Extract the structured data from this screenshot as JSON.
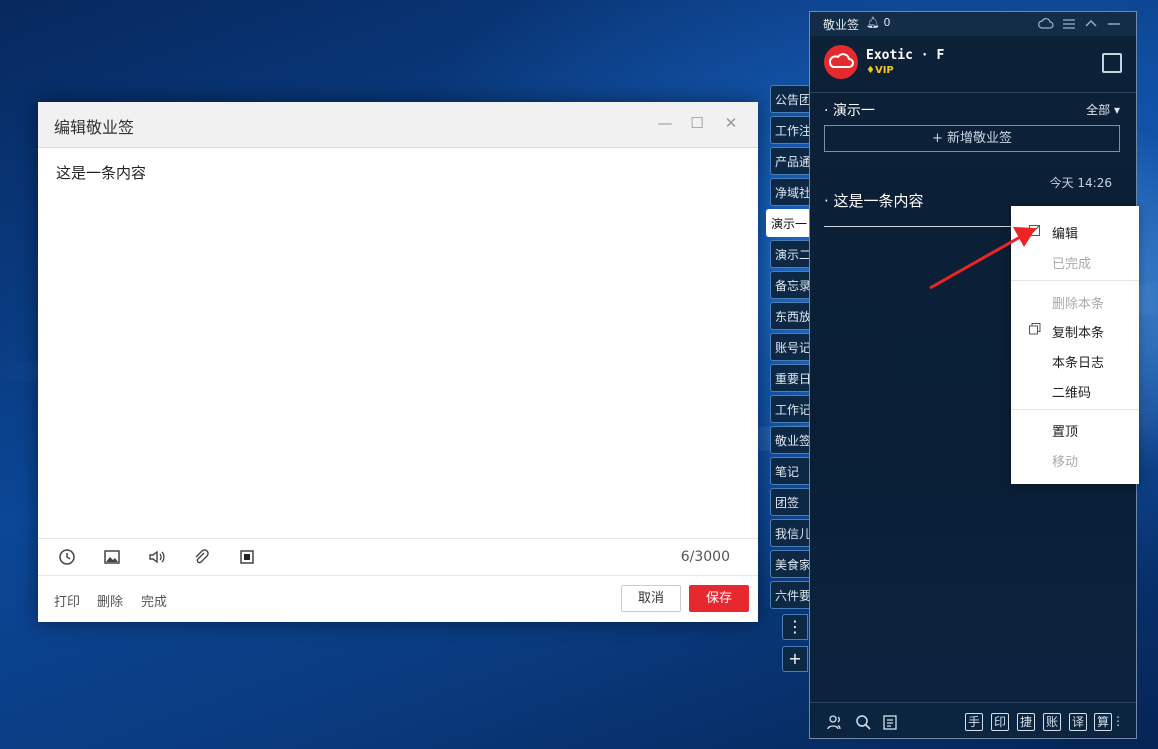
{
  "editor": {
    "title": "编辑敬业签",
    "content": "这是一条内容",
    "char_count": "6/3000",
    "footer_links": [
      "打印",
      "删除",
      "完成"
    ],
    "cancel_label": "取消",
    "save_label": "保存",
    "tool_icons": [
      "clock-icon",
      "image-icon",
      "speaker-icon",
      "attachment-icon",
      "stop-icon"
    ]
  },
  "tabs": [
    "公告团",
    "工作注",
    "产品通",
    "净域社",
    "演示一",
    "演示二",
    "备忘录",
    "东西放",
    "账号记",
    "重要日",
    "工作记",
    "敬业签",
    "笔记",
    "团签",
    "我信儿",
    "美食家",
    "六件要"
  ],
  "active_tab": "演示一",
  "tab_more": "⋮",
  "tab_add": "+",
  "panel": {
    "app_name": "敬业签",
    "notification_count": "0",
    "user_name": "Exotic · F",
    "vip_label": "VIP",
    "group_name": "演示一",
    "filter_label": "全部",
    "add_note_label": "+ 新增敬业签",
    "note_time": "今天 14:26",
    "note_text": "这是一条内容",
    "bottom_right_icons": [
      "手",
      "印",
      "捷",
      "账",
      "译",
      "算"
    ]
  },
  "context_menu": {
    "edit": "编辑",
    "done": "已完成",
    "delete": "删除本条",
    "copy": "复制本条",
    "log": "本条日志",
    "qrcode": "二维码",
    "pin": "置顶",
    "move": "移动"
  },
  "colors": {
    "accent_red": "#e8282f",
    "panel_bg": "#0b2037",
    "tab_border": "#4a7fb5"
  }
}
